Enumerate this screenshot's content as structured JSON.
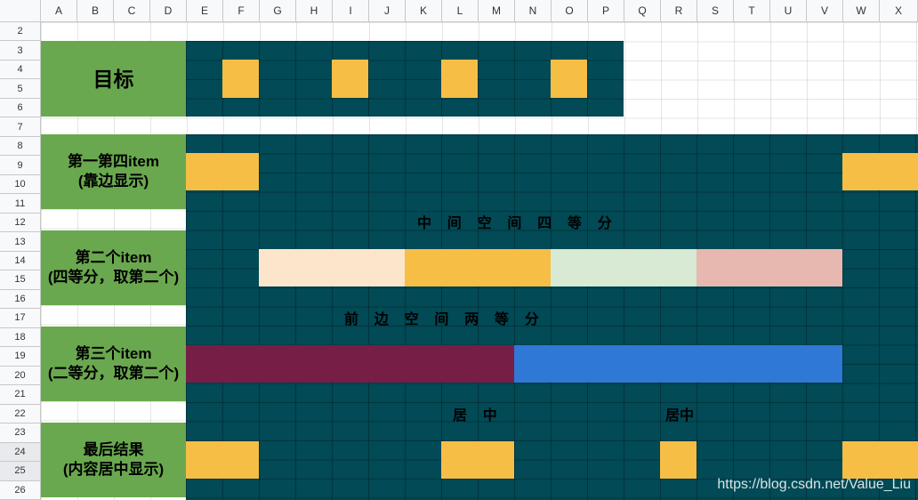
{
  "spreadsheet": {
    "column_headers": [
      "A",
      "B",
      "C",
      "D",
      "E",
      "F",
      "G",
      "H",
      "I",
      "J",
      "K",
      "L",
      "M",
      "N",
      "O",
      "P",
      "Q",
      "R",
      "S",
      "T",
      "U",
      "V",
      "W",
      "X"
    ],
    "row_headers": [
      "2",
      "3",
      "4",
      "5",
      "6",
      "7",
      "8",
      "9",
      "10",
      "11",
      "12",
      "13",
      "14",
      "15",
      "16",
      "17",
      "18",
      "19",
      "20",
      "21",
      "22",
      "23",
      "24",
      "25",
      "26"
    ],
    "selected_rows": [
      "24",
      "25"
    ]
  },
  "colors": {
    "container": "#014a56",
    "item_yellow": "#f6be45",
    "label_green": "#6aa84f",
    "peach": "#fde5cc",
    "mint": "#d8e9d4",
    "rose": "#e7b8b0",
    "maroon": "#761e46",
    "blue": "#2f78d5"
  },
  "sections": {
    "target": {
      "title": "目标"
    },
    "first_fourth": {
      "line1": "第一第四item",
      "line2": "(靠边显示)"
    },
    "second": {
      "line1": "第二个item",
      "line2": "(四等分，取第二个)"
    },
    "third": {
      "line1": "第三个item",
      "line2": "(二等分，取第二个)"
    },
    "final": {
      "line1": "最后结果",
      "line2": "(内容居中显示)"
    }
  },
  "annotations": {
    "middle_space": "中    间    空    间    四    等    分",
    "front_space": "前    边    空    间    两    等    分",
    "center_a": "居    中",
    "center_b": "居中"
  },
  "watermark": "https://blog.csdn.net/Value_Liu"
}
